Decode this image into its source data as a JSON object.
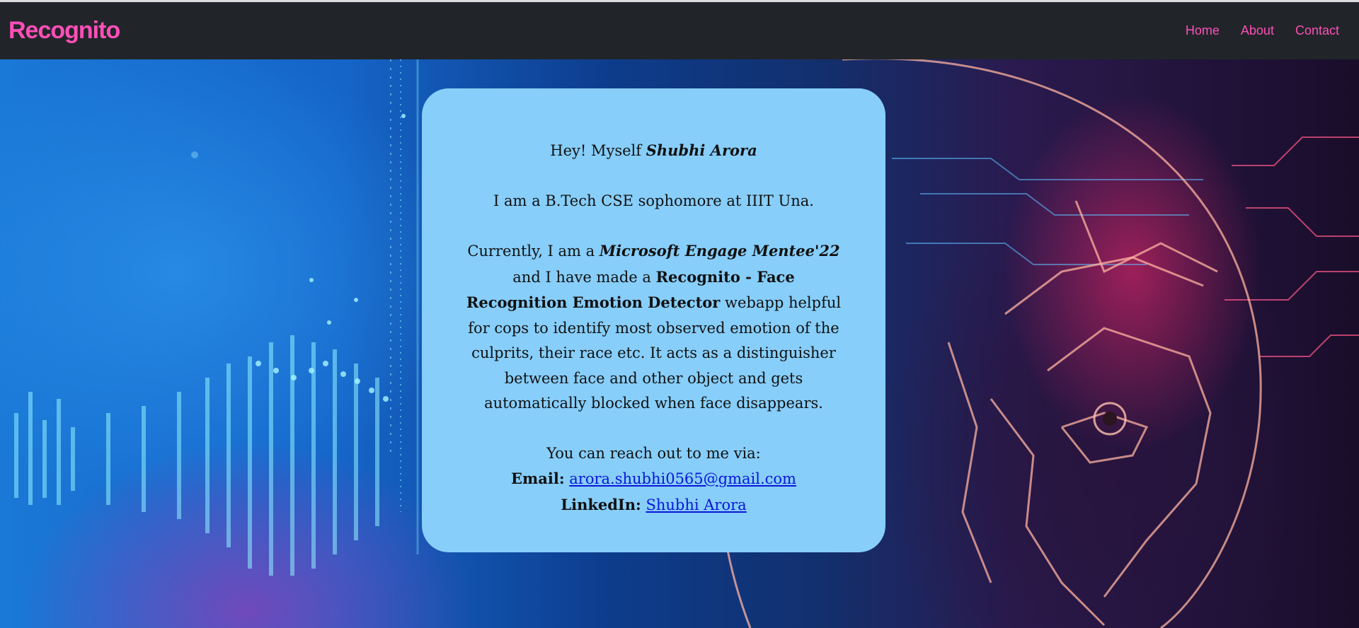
{
  "navbar": {
    "brand": "Recognito",
    "links": [
      "Home",
      "About",
      "Contact"
    ]
  },
  "about": {
    "intro_prefix": "Hey! Myself ",
    "intro_name": "Shubhi Arora",
    "education": "I am a B.Tech CSE sophomore at IIIT Una.",
    "desc_prefix": "Currently, I am a ",
    "desc_program": "Microsoft Engage Mentee'22",
    "desc_middle": " and I have made a ",
    "desc_project": "Recognito - Face Recognition Emotion Detector",
    "desc_rest": " webapp helpful for cops to identify most observed emotion of the culprits, their race etc. It acts as a distinguisher between face and other object and gets automatically blocked when face disappears.",
    "reach_out": "You can reach out to me via:",
    "email_label": "Email:",
    "email_value": "arora.shubhi0565@gmail.com",
    "linkedin_label": "LinkedIn:",
    "linkedin_value": "Shubhi Arora"
  },
  "colors": {
    "navbar_bg": "#212529",
    "brand": "#ff4fb8",
    "card_bg": "#87cefa",
    "link": "#0a16d8"
  }
}
